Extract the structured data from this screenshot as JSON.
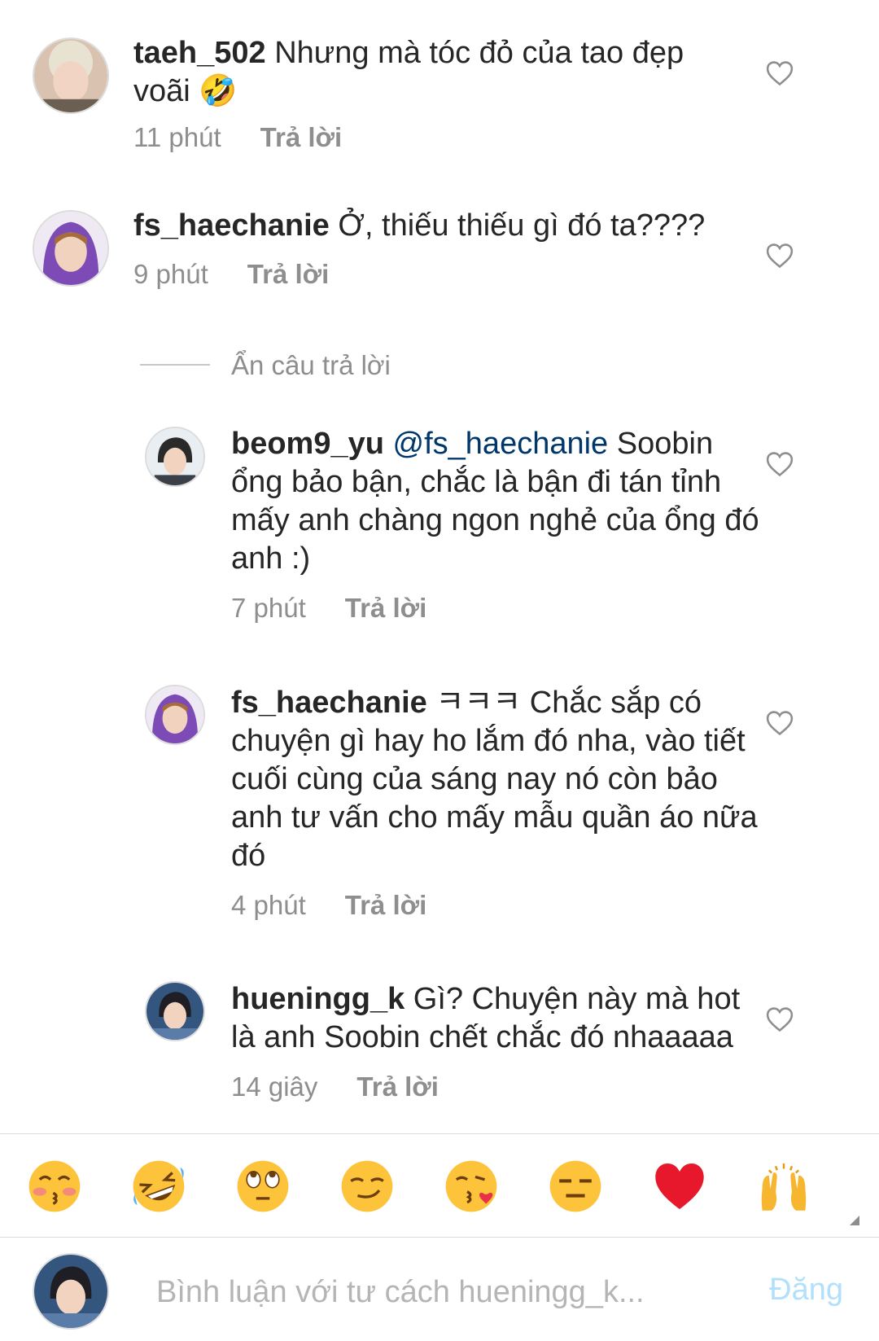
{
  "comments": [
    {
      "user": "taeh_502",
      "text": "Nhưng mà tóc đỏ của tao đẹp voãi 🤣",
      "time": "11 phút",
      "reply": "Trả lời"
    },
    {
      "user": "fs_haechanie",
      "text": "Ở, thiếu thiếu gì đó ta????",
      "time": "9 phút",
      "reply": "Trả lời"
    },
    {
      "user": "beom9_yu",
      "mention": "@fs_haechanie",
      "text": "Soobin ổng bảo bận, chắc là bận đi tán tỉnh mấy anh chàng ngon nghẻ của ổng đó anh :)",
      "time": "7 phút",
      "reply": "Trả lời"
    },
    {
      "user": "fs_haechanie",
      "text": "ㅋㅋㅋ Chắc sắp có chuyện gì hay ho lắm đó nha, vào tiết cuối cùng của sáng nay nó còn bảo anh tư vấn cho mấy mẫu quần áo nữa đó",
      "time": "4 phút",
      "reply": "Trả lời"
    },
    {
      "user": "hueningg_k",
      "text": "Gì? Chuyện này mà hot là anh Soobin chết chắc đó nhaaaaa",
      "time": "14 giây",
      "reply": "Trả lời"
    }
  ],
  "hide_replies": "Ẩn câu trả lời",
  "emoji_bar": [
    "😚",
    "🤣",
    "🙄",
    "😏",
    "😘",
    "😑",
    "❤️",
    "🙌"
  ],
  "composer": {
    "placeholder": "Bình luận với tư cách hueningg_k...",
    "post_label": "Đăng"
  },
  "colors": {
    "muted": "#8e8e8e",
    "mention": "#00376b",
    "post": "#b2dffc"
  }
}
